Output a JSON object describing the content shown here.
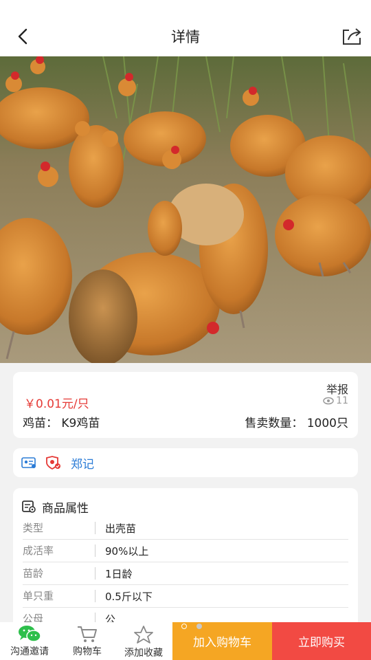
{
  "header": {
    "title": "详情"
  },
  "product": {
    "price": "￥0.01元/只",
    "report_label": "举报",
    "views": "11",
    "breed": "鸡苗：  K9鸡苗",
    "quantity": "售卖数量：  1000只"
  },
  "seller": {
    "name": "郑记"
  },
  "attributes": {
    "title": "商品属性",
    "rows": [
      {
        "key": "类型",
        "value": "出壳苗"
      },
      {
        "key": "成活率",
        "value": "90%以上"
      },
      {
        "key": "苗龄",
        "value": "1日龄"
      },
      {
        "key": "单只重",
        "value": "0.5斤以下"
      },
      {
        "key": "公母",
        "value": "公"
      }
    ]
  },
  "bottom_bar": {
    "invite_label": "沟通邀请",
    "cart_label": "购物车",
    "favorite_label": "添加收藏",
    "add_to_cart_label": "加入购物车",
    "buy_now_label": "立即购买"
  },
  "colors": {
    "price": "#e53935",
    "seller_link": "#2a7bd6",
    "add_to_cart_bg": "#f5a623",
    "buy_now_bg": "#f24a43",
    "wechat_green": "#2dbf4b"
  },
  "icons": [
    "back-arrow-icon",
    "share-icon",
    "eye-icon",
    "id-card-icon",
    "verified-shield-icon",
    "attributes-icon",
    "wechat-icon",
    "cart-icon",
    "star-icon"
  ]
}
